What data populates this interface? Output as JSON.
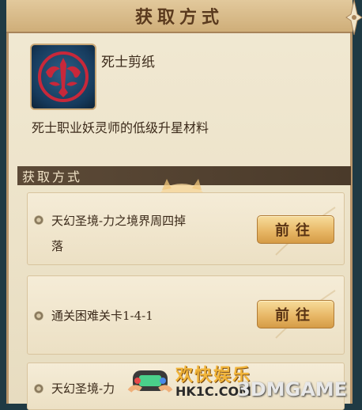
{
  "dialog": {
    "title": "获取方式"
  },
  "item": {
    "icon": "red-sword-emblem-icon",
    "name": "死士剪纸",
    "description": "死士职业妖灵师的低级升星材料"
  },
  "sources_section": {
    "label": "获取方式",
    "sources": [
      {
        "line1": "天幻圣境-力之境界周四掉",
        "line2": "落",
        "button": "前往"
      },
      {
        "line1": "通关困难关卡1-4-1",
        "line2": "",
        "button": "前往"
      },
      {
        "line1": "天幻圣境-力",
        "line2": "",
        "button": ""
      }
    ]
  },
  "watermark": {
    "cn": "欢快娱乐",
    "site": "HK1C.COM",
    "brand": "3DMGAME"
  },
  "colors": {
    "title_bar": "#cfae79",
    "section_bar": "#4a3a2a",
    "button": "#e8b867",
    "icon_bg": "#163a5c",
    "icon_fg": "#c8283a"
  }
}
